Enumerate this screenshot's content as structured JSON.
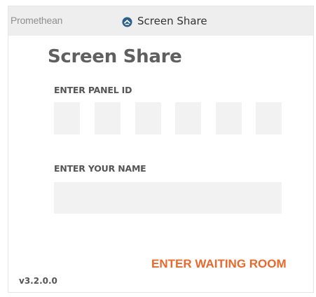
{
  "titlebar": {
    "brand": "Promethean",
    "app_icon": "screen-share-app-icon",
    "title": "Screen Share"
  },
  "main": {
    "heading": "Screen Share",
    "panel_id_label": "ENTER PANEL ID",
    "panel_id_digits": [
      "",
      "",
      "",
      "",
      "",
      ""
    ],
    "name_label": "ENTER YOUR NAME",
    "name_value": "",
    "waiting_room_button": "ENTER WAITING ROOM"
  },
  "footer": {
    "version": "v3.2.0.0"
  },
  "colors": {
    "accent": "#e8692c",
    "titlebar_bg": "#eeeeee",
    "input_bg": "#f2f2f2",
    "heading": "#5f5f5f",
    "icon_blue": "#2b5f8c"
  }
}
